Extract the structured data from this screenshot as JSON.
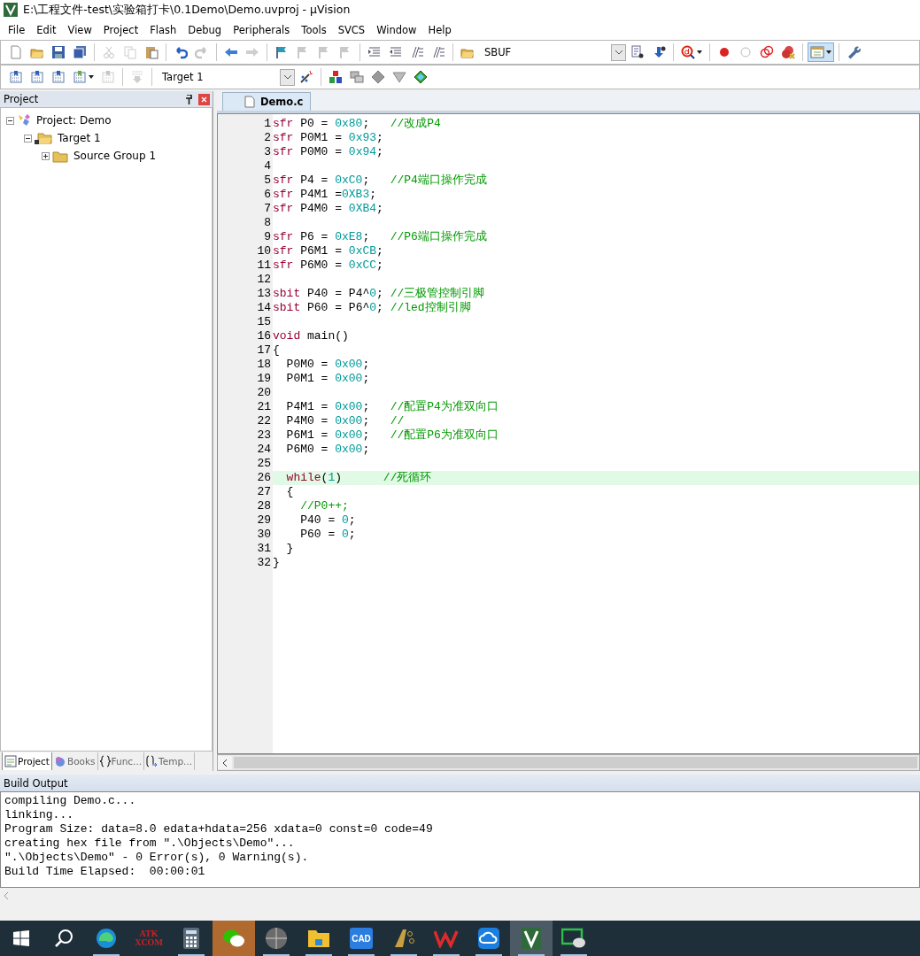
{
  "window": {
    "title": "E:\\工程文件-test\\实验箱打卡\\0.1Demo\\Demo.uvproj - µVision"
  },
  "menu": [
    "File",
    "Edit",
    "View",
    "Project",
    "Flash",
    "Debug",
    "Peripherals",
    "Tools",
    "SVCS",
    "Window",
    "Help"
  ],
  "toolbar_1": [
    {
      "kind": "new",
      "disabled": false
    },
    {
      "kind": "open",
      "disabled": false
    },
    {
      "kind": "save",
      "disabled": false
    },
    {
      "kind": "saveall",
      "disabled": false
    },
    {
      "kind": "sep"
    },
    {
      "kind": "cut",
      "disabled": true
    },
    {
      "kind": "copy",
      "disabled": true
    },
    {
      "kind": "paste",
      "disabled": false
    },
    {
      "kind": "sep"
    },
    {
      "kind": "undo",
      "disabled": false
    },
    {
      "kind": "redo",
      "disabled": true
    },
    {
      "kind": "sep"
    },
    {
      "kind": "back",
      "disabled": false
    },
    {
      "kind": "forward",
      "disabled": true
    },
    {
      "kind": "sep"
    },
    {
      "kind": "flag",
      "disabled": false
    },
    {
      "kind": "bookmark",
      "disabled": true
    },
    {
      "kind": "bookmark",
      "disabled": true
    },
    {
      "kind": "bookmark",
      "disabled": true
    },
    {
      "kind": "sep"
    },
    {
      "kind": "indent",
      "disabled": false
    },
    {
      "kind": "outdent",
      "disabled": false
    },
    {
      "kind": "comment",
      "disabled": false
    },
    {
      "kind": "uncomment",
      "disabled": false
    },
    {
      "kind": "sep"
    },
    {
      "kind": "findfolder",
      "disabled": false
    },
    {
      "kind": "combo",
      "value": "SBUF"
    },
    {
      "kind": "findfile",
      "disabled": false
    },
    {
      "kind": "jump",
      "disabled": false
    },
    {
      "kind": "sep"
    },
    {
      "kind": "debug",
      "disabled": false
    },
    {
      "kind": "sep"
    },
    {
      "kind": "bp",
      "disabled": false
    },
    {
      "kind": "bpoff",
      "disabled": false
    },
    {
      "kind": "bprings",
      "disabled": false
    },
    {
      "kind": "bpkill",
      "disabled": false
    },
    {
      "kind": "sep"
    },
    {
      "kind": "windows",
      "disabled": false,
      "pressed": true
    },
    {
      "kind": "sep"
    },
    {
      "kind": "wrench",
      "disabled": false
    }
  ],
  "toolbar_2": [
    {
      "kind": "translate",
      "disabled": false
    },
    {
      "kind": "build",
      "disabled": false
    },
    {
      "kind": "rebuild",
      "disabled": false
    },
    {
      "kind": "batch",
      "disabled": false
    },
    {
      "kind": "stop",
      "disabled": true
    },
    {
      "kind": "sep"
    },
    {
      "kind": "load",
      "disabled": true
    },
    {
      "kind": "sep"
    },
    {
      "kind": "combo",
      "value": "Target 1"
    },
    {
      "kind": "wand",
      "disabled": false
    },
    {
      "kind": "sep"
    },
    {
      "kind": "manage",
      "disabled": false
    },
    {
      "kind": "stack",
      "disabled": false
    },
    {
      "kind": "diamond",
      "disabled": false
    },
    {
      "kind": "funnel",
      "disabled": false
    },
    {
      "kind": "pack",
      "disabled": false
    }
  ],
  "project_panel": {
    "title": "Project",
    "tree": [
      {
        "label": "Project: Demo",
        "kind": "project",
        "expanded": true,
        "children": [
          {
            "label": "Target 1",
            "kind": "target",
            "expanded": true,
            "children": [
              {
                "label": "Source Group 1",
                "kind": "group",
                "expanded": false
              }
            ]
          }
        ]
      }
    ],
    "tabs": [
      {
        "label": "Project",
        "kind": "project",
        "selected": true
      },
      {
        "label": "Books",
        "kind": "books",
        "selected": false
      },
      {
        "label": "Func...",
        "kind": "func",
        "selected": false
      },
      {
        "label": "Temp...",
        "kind": "temp",
        "selected": false
      }
    ]
  },
  "editor": {
    "tabs": [
      {
        "label": "Demo.c",
        "selected": true
      }
    ],
    "lines": [
      {
        "number": "1",
        "current": false,
        "tokens": [
          {
            "kind": "keyword",
            "text": "sfr"
          },
          {
            "kind": "plain",
            "text": " P0 = "
          },
          {
            "kind": "number",
            "text": "0x80"
          },
          {
            "kind": "plain",
            "text": ";   "
          },
          {
            "kind": "comment",
            "text": "//改成P4"
          }
        ]
      },
      {
        "number": "2",
        "current": false,
        "tokens": [
          {
            "kind": "keyword",
            "text": "sfr"
          },
          {
            "kind": "plain",
            "text": " P0M1 = "
          },
          {
            "kind": "number",
            "text": "0x93"
          },
          {
            "kind": "plain",
            "text": ";"
          }
        ]
      },
      {
        "number": "3",
        "current": false,
        "tokens": [
          {
            "kind": "keyword",
            "text": "sfr"
          },
          {
            "kind": "plain",
            "text": " P0M0 = "
          },
          {
            "kind": "number",
            "text": "0x94"
          },
          {
            "kind": "plain",
            "text": ";"
          }
        ]
      },
      {
        "number": "4",
        "current": false
      },
      {
        "number": "5",
        "current": false,
        "tokens": [
          {
            "kind": "keyword",
            "text": "sfr"
          },
          {
            "kind": "plain",
            "text": " P4 = "
          },
          {
            "kind": "number",
            "text": "0xC0"
          },
          {
            "kind": "plain",
            "text": ";   "
          },
          {
            "kind": "comment",
            "text": "//P4端口操作完成"
          }
        ]
      },
      {
        "number": "6",
        "current": false,
        "tokens": [
          {
            "kind": "keyword",
            "text": "sfr"
          },
          {
            "kind": "plain",
            "text": " P4M1 ="
          },
          {
            "kind": "number",
            "text": "0XB3"
          },
          {
            "kind": "plain",
            "text": ";"
          }
        ]
      },
      {
        "number": "7",
        "current": false,
        "tokens": [
          {
            "kind": "keyword",
            "text": "sfr"
          },
          {
            "kind": "plain",
            "text": " P4M0 = "
          },
          {
            "kind": "number",
            "text": "0XB4"
          },
          {
            "kind": "plain",
            "text": ";"
          }
        ]
      },
      {
        "number": "8",
        "current": false
      },
      {
        "number": "9",
        "current": false,
        "tokens": [
          {
            "kind": "keyword",
            "text": "sfr"
          },
          {
            "kind": "plain",
            "text": " P6 = "
          },
          {
            "kind": "number",
            "text": "0xE8"
          },
          {
            "kind": "plain",
            "text": ";   "
          },
          {
            "kind": "comment",
            "text": "//P6端口操作完成"
          }
        ]
      },
      {
        "number": "10",
        "current": false,
        "tokens": [
          {
            "kind": "keyword",
            "text": "sfr"
          },
          {
            "kind": "plain",
            "text": " P6M1 = "
          },
          {
            "kind": "number",
            "text": "0xCB"
          },
          {
            "kind": "plain",
            "text": ";"
          }
        ]
      },
      {
        "number": "11",
        "current": false,
        "tokens": [
          {
            "kind": "keyword",
            "text": "sfr"
          },
          {
            "kind": "plain",
            "text": " P6M0 = "
          },
          {
            "kind": "number",
            "text": "0xCC"
          },
          {
            "kind": "plain",
            "text": ";"
          }
        ]
      },
      {
        "number": "12",
        "current": false
      },
      {
        "number": "13",
        "current": false,
        "tokens": [
          {
            "kind": "keyword",
            "text": "sbit"
          },
          {
            "kind": "plain",
            "text": " P40 = P4^"
          },
          {
            "kind": "number",
            "text": "0"
          },
          {
            "kind": "plain",
            "text": "; "
          },
          {
            "kind": "comment",
            "text": "//三极管控制引脚"
          }
        ]
      },
      {
        "number": "14",
        "current": false,
        "tokens": [
          {
            "kind": "keyword",
            "text": "sbit"
          },
          {
            "kind": "plain",
            "text": " P60 = P6^"
          },
          {
            "kind": "number",
            "text": "0"
          },
          {
            "kind": "plain",
            "text": "; "
          },
          {
            "kind": "comment",
            "text": "//led控制引脚"
          }
        ]
      },
      {
        "number": "15",
        "current": false
      },
      {
        "number": "16",
        "current": false,
        "tokens": [
          {
            "kind": "keyword",
            "text": "void"
          },
          {
            "kind": "plain",
            "text": " main()"
          }
        ]
      },
      {
        "number": "17",
        "current": false,
        "tokens": [
          {
            "kind": "plain",
            "text": "{"
          }
        ]
      },
      {
        "number": "18",
        "current": false,
        "tokens": [
          {
            "kind": "plain",
            "text": "  P0M0 = "
          },
          {
            "kind": "number",
            "text": "0x00"
          },
          {
            "kind": "plain",
            "text": ";"
          }
        ]
      },
      {
        "number": "19",
        "current": false,
        "tokens": [
          {
            "kind": "plain",
            "text": "  P0M1 = "
          },
          {
            "kind": "number",
            "text": "0x00"
          },
          {
            "kind": "plain",
            "text": ";"
          }
        ]
      },
      {
        "number": "20",
        "current": false
      },
      {
        "number": "21",
        "current": false,
        "tokens": [
          {
            "kind": "plain",
            "text": "  P4M1 = "
          },
          {
            "kind": "number",
            "text": "0x00"
          },
          {
            "kind": "plain",
            "text": ";   "
          },
          {
            "kind": "comment",
            "text": "//配置P4为准双向口"
          }
        ]
      },
      {
        "number": "22",
        "current": false,
        "tokens": [
          {
            "kind": "plain",
            "text": "  P4M0 = "
          },
          {
            "kind": "number",
            "text": "0x00"
          },
          {
            "kind": "plain",
            "text": ";   "
          },
          {
            "kind": "comment",
            "text": "//"
          }
        ]
      },
      {
        "number": "23",
        "current": false,
        "tokens": [
          {
            "kind": "plain",
            "text": "  P6M1 = "
          },
          {
            "kind": "number",
            "text": "0x00"
          },
          {
            "kind": "plain",
            "text": ";   "
          },
          {
            "kind": "comment",
            "text": "//配置P6为准双向口"
          }
        ]
      },
      {
        "number": "24",
        "current": false,
        "tokens": [
          {
            "kind": "plain",
            "text": "  P6M0 = "
          },
          {
            "kind": "number",
            "text": "0x00"
          },
          {
            "kind": "plain",
            "text": ";"
          }
        ]
      },
      {
        "number": "25",
        "current": false
      },
      {
        "number": "26",
        "current": true,
        "tokens": [
          {
            "kind": "keyword",
            "text": "  while"
          },
          {
            "kind": "plain",
            "text": "("
          },
          {
            "kind": "number",
            "text": "1"
          },
          {
            "kind": "plain",
            "text": ")      "
          },
          {
            "kind": "comment",
            "text": "//死循环"
          }
        ]
      },
      {
        "number": "27",
        "current": false,
        "tokens": [
          {
            "kind": "plain",
            "text": "  {"
          }
        ]
      },
      {
        "number": "28",
        "current": false,
        "tokens": [
          {
            "kind": "comment",
            "text": "    //P0++;"
          }
        ]
      },
      {
        "number": "29",
        "current": false,
        "tokens": [
          {
            "kind": "plain",
            "text": "    P40 = "
          },
          {
            "kind": "number",
            "text": "0"
          },
          {
            "kind": "plain",
            "text": ";"
          }
        ]
      },
      {
        "number": "30",
        "current": false,
        "tokens": [
          {
            "kind": "plain",
            "text": "    P60 = "
          },
          {
            "kind": "number",
            "text": "0"
          },
          {
            "kind": "plain",
            "text": ";"
          }
        ]
      },
      {
        "number": "31",
        "current": false,
        "tokens": [
          {
            "kind": "plain",
            "text": "  }"
          }
        ]
      },
      {
        "number": "32",
        "current": false,
        "tokens": [
          {
            "kind": "plain",
            "text": "}"
          }
        ]
      }
    ]
  },
  "build_output": {
    "title": "Build Output",
    "lines": [
      "compiling Demo.c...",
      "linking...",
      "Program Size: data=8.0 edata+hdata=256 xdata=0 const=0 code=49",
      "creating hex file from \".\\Objects\\Demo\"...",
      "\".\\Objects\\Demo\" - 0 Error(s), 0 Warning(s).",
      "Build Time Elapsed:  00:00:01"
    ]
  },
  "taskbar": {
    "apps": [
      {
        "kind": "edge",
        "running": true,
        "active": false,
        "attention": false
      },
      {
        "kind": "atk",
        "label": "ATK",
        "sublabel": "XCOM",
        "running": false,
        "active": false,
        "attention": false
      },
      {
        "kind": "calc",
        "running": true,
        "active": false,
        "attention": false
      },
      {
        "kind": "wechat",
        "running": false,
        "active": false,
        "attention": true
      },
      {
        "kind": "photo",
        "running": true,
        "active": false,
        "attention": false
      },
      {
        "kind": "explorer",
        "running": true,
        "active": false,
        "attention": false
      },
      {
        "kind": "cad",
        "label": "CAD",
        "running": true,
        "active": false,
        "attention": false
      },
      {
        "kind": "altium",
        "running": true,
        "active": false,
        "attention": false
      },
      {
        "kind": "wps",
        "running": true,
        "active": false,
        "attention": false
      },
      {
        "kind": "cloud",
        "running": true,
        "active": false,
        "attention": false
      },
      {
        "kind": "uvision",
        "running": true,
        "active": true,
        "attention": false
      },
      {
        "kind": "chat",
        "running": true,
        "active": false,
        "attention": false
      }
    ]
  }
}
